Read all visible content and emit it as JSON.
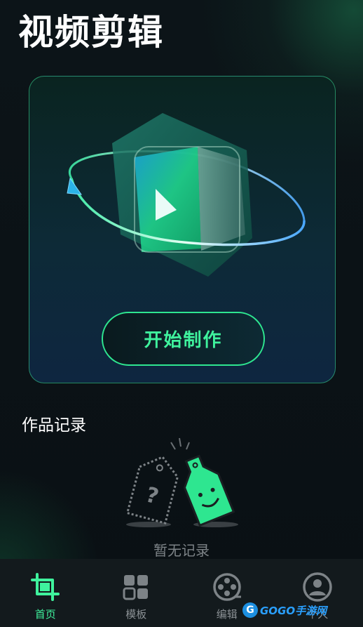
{
  "app_title": "视频剪辑",
  "hero": {
    "start_button_label": "开始制作",
    "illustration_icon": "video-play-cube-icon"
  },
  "records": {
    "section_title": "作品记录",
    "empty_text": "暂无记录",
    "empty_icon": "empty-tags-icon"
  },
  "tabs": [
    {
      "label": "首页",
      "icon": "crop-icon",
      "active": true
    },
    {
      "label": "模板",
      "icon": "grid-icon",
      "active": false
    },
    {
      "label": "编辑",
      "icon": "film-reel-icon",
      "active": false
    },
    {
      "label": "个人",
      "icon": "user-icon",
      "active": false
    }
  ],
  "watermark": {
    "text": "GOGO手游网",
    "icon": "gogo-logo-icon"
  },
  "colors": {
    "accent": "#3ff29d",
    "background": "#0a1015",
    "tab_bar": "#131a1d",
    "inactive_text": "#8a9094"
  }
}
